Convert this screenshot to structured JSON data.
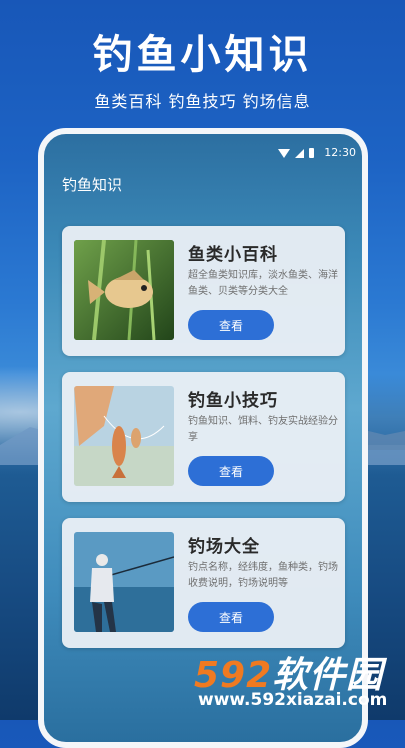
{
  "promo": {
    "title": "钓鱼小知识",
    "subtitle": "鱼类百科 钓鱼技巧 钓场信息"
  },
  "status_bar": {
    "time": "12:30",
    "icons": [
      "wifi-icon",
      "signal-icon",
      "battery-icon"
    ]
  },
  "app": {
    "title": "钓鱼知识"
  },
  "cards": [
    {
      "title": "鱼类小百科",
      "desc": "超全鱼类知识库，淡水鱼类、海洋鱼类、贝类等分类大全",
      "button": "查看",
      "image": "fish-image"
    },
    {
      "title": "钓鱼小技巧",
      "desc": "钓鱼知识、饵料、钓友实战经验分享",
      "button": "查看",
      "image": "caught-fish-image"
    },
    {
      "title": "钓场大全",
      "desc": "钓点名称，经纬度，鱼种类，钓场收费说明，钓场说明等",
      "button": "查看",
      "image": "angler-image"
    }
  ],
  "watermark": {
    "logo_num": "592",
    "logo_text": "软件园",
    "url": "www.592xiazai.com"
  },
  "colors": {
    "button": "#2d6fd6",
    "watermark_accent": "#f07a21"
  }
}
